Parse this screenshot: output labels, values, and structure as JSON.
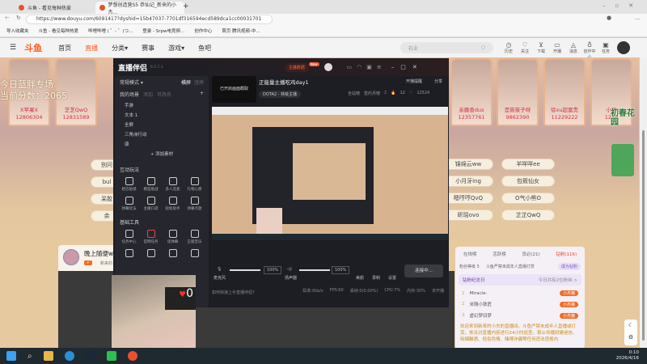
{
  "browser": {
    "tabs": [
      {
        "title": "斗鱼 - 看见每种热爱"
      },
      {
        "title": "梦想创造营S5 恭仙记_新来的小杰..."
      }
    ],
    "url": "https://www.douyu.com/6091417?dyshid=15b47037-7701df316594ecd589dca1cc00031701",
    "bookmarks": [
      "导入收藏夹",
      "斗鱼 - 看见每种热爱",
      "哔哩哔哩 ( ゜- ゜)つ...",
      "登录 - Srpw电竞俱...",
      "创作中心",
      "首页 腾讯视频-中..."
    ]
  },
  "site": {
    "logo": "斗鱼",
    "nav": [
      "首页",
      "直播",
      "分类▾",
      "赛事",
      "游戏▾",
      "鱼吧"
    ],
    "active_nav": "直播",
    "search_placeholder": "石业",
    "toolbar": [
      {
        "icon": "clock-icon",
        "label": "历史"
      },
      {
        "icon": "heart-icon",
        "label": "关注"
      },
      {
        "icon": "download-icon",
        "label": "下载"
      },
      {
        "icon": "video-icon",
        "label": "开播"
      },
      {
        "icon": "bell-icon",
        "label": "消息"
      },
      {
        "icon": "bulb-icon",
        "label": "创作中心"
      },
      {
        "icon": "gift-icon",
        "label": "任务"
      }
    ]
  },
  "banner": {
    "score_line1": "今日蓝胖专场",
    "score_line2": "当前分数：2065",
    "cards": [
      {
        "name": "X苹果X",
        "id": "12806304"
      },
      {
        "name": "芝芝QwQ",
        "id": "12831589"
      },
      {
        "name": "亲厭香dus",
        "id": "12357761"
      },
      {
        "name": "是筱筱子呀",
        "id": "9862390"
      },
      {
        "name": "徐xu超富贵",
        "id": "11229222"
      },
      {
        "name": "小月",
        "id": "1210"
      }
    ],
    "left_pills": [
      "别问",
      "bul",
      "呆胶",
      "余"
    ],
    "pills_col1": [
      "锦绵云ww",
      "小月牙ing",
      "嗯哼哼QvQ",
      "昕瑶ovo"
    ],
    "pills_col2": [
      "羊咩咩ee",
      "包筱仙女",
      "O气小熊O",
      "芷芷QwQ"
    ],
    "event_badge": "初春花园"
  },
  "room": {
    "name": "晚上随便w",
    "tag": "新来的"
  },
  "chat": {
    "tabs": [
      "在线榜",
      "活跃榜",
      "贡必(21)",
      "钻粉(116)"
    ],
    "fan_level": "粉丝等级 5",
    "notice": "斗鱼严禁未成年人直播打赏",
    "join_button": "成为钻粉",
    "anniv": "钻粉纪念日",
    "anniv_right": "今日共有2位粉丝 >",
    "ranks": [
      {
        "n": "1",
        "name": "Miracle-",
        "badge": "小杰猪"
      },
      {
        "n": "2",
        "name": "米隔小铁匠",
        "badge": "小杰猪"
      },
      {
        "n": "3",
        "name": "虚幻梦旧梦",
        "badge": "小杰猪"
      }
    ],
    "welcome": "欢迎来到新来的小杰的直播间。斗鱼严禁未成年人直播或打赏，依法对直播内容进行24小时巡查，禁止传播封建迷信、吸烟酗酒、低俗色情、赌博诈骗等任何违法违规内"
  },
  "app": {
    "title": "直播伴侣",
    "version": "6.5.7.1",
    "anchor_data": "主播数据",
    "new_badge": "New",
    "mode": "常规模式 ▾",
    "mode_opts": [
      "横屏",
      "竖屏"
    ],
    "scene_header": "我的场景",
    "scene_opts": [
      "添加",
      "可改名"
    ],
    "scenes": [
      "手游",
      "文本 1",
      "全屏",
      "三角洲行动",
      "康"
    ],
    "add_material": "+ 添加素材",
    "cover": "已开启画面截取",
    "stream_title": "正能量主播吃鸡day1",
    "category": "DOTA2 - 林级主播",
    "remind": "开播提醒",
    "share": "分享",
    "stats": {
      "all": "全站榜",
      "guard": "签约月榜",
      "guard_n": "2",
      "fire": "12",
      "heart": "12524"
    },
    "interact_header": "互动玩法",
    "interact": [
      "相芯贴纸",
      "模型挑战",
      "多人连麦",
      "礼物心愿",
      "弹幕玩法",
      "主播口袋",
      "轻松助手",
      "弹幕点歌"
    ],
    "tools_header": "基础工具",
    "tools": [
      "任务中心",
      "官网任务",
      "读弹幕",
      "正版音乐",
      "",
      "",
      "",
      ""
    ],
    "mic": "麦克风",
    "mic_vol": "100%",
    "speaker": "扬声器",
    "speaker_vol": "100%",
    "effects": "美颜",
    "record": "录制",
    "settings": "设置",
    "live_button": "连接中...",
    "help": "如何快速上手直播伴侣?",
    "status": [
      "码率:0kb/s",
      "FPS:60",
      "丢帧:0(0.00%)",
      "CPU:7%",
      "内存:30%",
      "未开播"
    ]
  },
  "taskbar": {
    "time": "0:10",
    "date": "2026/4/16"
  }
}
